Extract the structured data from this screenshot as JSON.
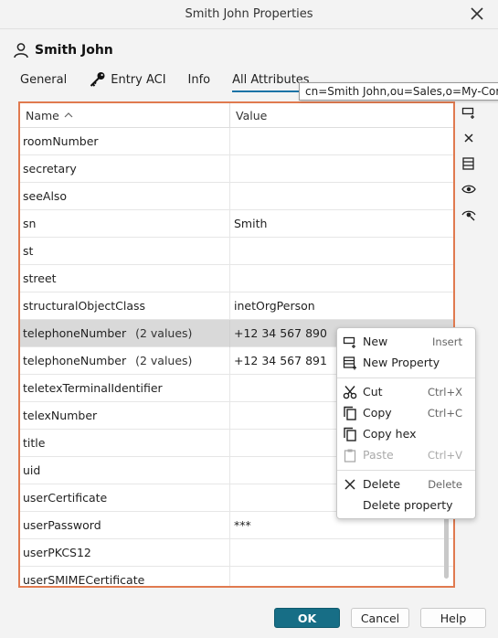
{
  "window": {
    "title": "Smith John Properties"
  },
  "entry": {
    "name": "Smith John"
  },
  "tabs": [
    {
      "label": "General"
    },
    {
      "label": "Entry ACI"
    },
    {
      "label": "Info"
    },
    {
      "label": "All Attributes"
    }
  ],
  "tooltip": "cn=Smith John,ou=Sales,o=My-Cor",
  "table": {
    "headers": {
      "name": "Name",
      "value": "Value"
    },
    "rows": [
      {
        "name": "roomNumber",
        "count": "",
        "value": ""
      },
      {
        "name": "secretary",
        "count": "",
        "value": ""
      },
      {
        "name": "seeAlso",
        "count": "",
        "value": ""
      },
      {
        "name": "sn",
        "count": "",
        "value": "Smith"
      },
      {
        "name": "st",
        "count": "",
        "value": ""
      },
      {
        "name": "street",
        "count": "",
        "value": ""
      },
      {
        "name": "structuralObjectClass",
        "count": "",
        "value": "inetOrgPerson"
      },
      {
        "name": "telephoneNumber",
        "count": "(2 values)",
        "value": "+12 34 567 890"
      },
      {
        "name": "telephoneNumber",
        "count": "(2 values)",
        "value": "+12 34 567 891"
      },
      {
        "name": "teletexTerminalIdentifier",
        "count": "",
        "value": ""
      },
      {
        "name": "telexNumber",
        "count": "",
        "value": ""
      },
      {
        "name": "title",
        "count": "",
        "value": ""
      },
      {
        "name": "uid",
        "count": "",
        "value": ""
      },
      {
        "name": "userCertificate",
        "count": "",
        "value": ""
      },
      {
        "name": "userPassword",
        "count": "",
        "value": "***"
      },
      {
        "name": "userPKCS12",
        "count": "",
        "value": ""
      },
      {
        "name": "userSMIMECertificate",
        "count": "",
        "value": ""
      }
    ]
  },
  "context_menu": {
    "items": [
      {
        "label": "New",
        "shortcut": "Insert",
        "icon": "new-value-icon"
      },
      {
        "label": "New Property",
        "shortcut": "",
        "icon": "new-property-icon"
      },
      {
        "label": "Cut",
        "shortcut": "Ctrl+X",
        "icon": "scissors-icon"
      },
      {
        "label": "Copy",
        "shortcut": "Ctrl+C",
        "icon": "copy-icon"
      },
      {
        "label": "Copy hex",
        "shortcut": "",
        "icon": "copy-hex-icon"
      },
      {
        "label": "Paste",
        "shortcut": "Ctrl+V",
        "icon": "paste-icon"
      },
      {
        "label": "Delete",
        "shortcut": "Delete",
        "icon": "x-icon"
      },
      {
        "label": "Delete property",
        "shortcut": "",
        "icon": ""
      }
    ]
  },
  "buttons": {
    "ok": "OK",
    "cancel": "Cancel",
    "help": "Help"
  },
  "colors": {
    "accent": "#176e86",
    "highlight_border": "#e07a4f",
    "selected_row": "#d9d9d9"
  }
}
